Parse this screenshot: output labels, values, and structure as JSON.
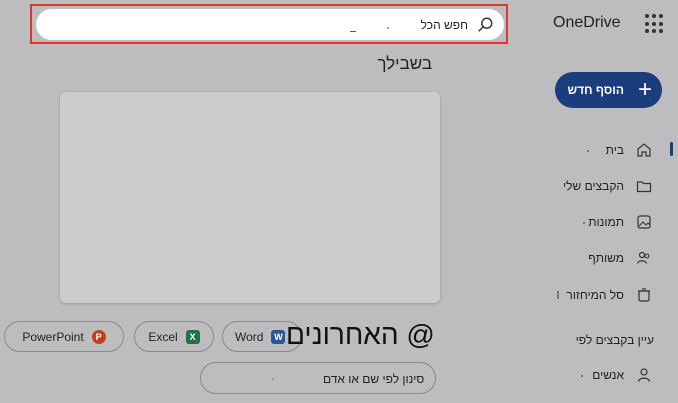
{
  "app": {
    "brand": "OneDrive"
  },
  "search": {
    "text": "חפש הכל"
  },
  "nav": {
    "new_button": "הוסף חדש",
    "items": [
      {
        "label": "בית",
        "icon": "home-icon",
        "active": true
      },
      {
        "label": "הקבצים שלי",
        "icon": "folder-icon"
      },
      {
        "label": "תמונות",
        "icon": "photos-icon"
      },
      {
        "label": "משותף",
        "icon": "people-icon"
      },
      {
        "label": "סל המיחזור",
        "icon": "recycle-bin-icon"
      }
    ],
    "browse_heading": "עיין בקבצים לפי",
    "people": {
      "label": "אנשים",
      "icon": "person-icon"
    }
  },
  "main": {
    "for_you": "בשבילך",
    "recent_title": "האחרונים @",
    "filters": [
      {
        "label": "Word",
        "icon_letter": "W",
        "color": "#2b579a"
      },
      {
        "label": "Excel",
        "icon_letter": "X",
        "color": "#217346"
      },
      {
        "label": "PowerPoint",
        "icon_letter": "P",
        "color": "#c43e1c"
      }
    ],
    "filter_placeholder": "סינון לפי שם או אדם"
  },
  "colors": {
    "accent": "#1b3d7d",
    "highlight": "#e0352b",
    "background": "#bdbdbf"
  }
}
